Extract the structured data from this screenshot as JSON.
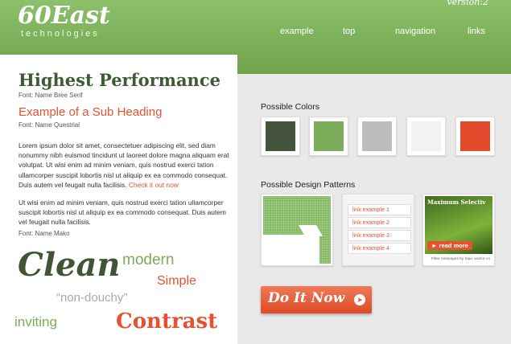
{
  "header": {
    "logo": "60East",
    "logo_sub": "technologies",
    "version": "version:2",
    "nav": [
      "example",
      "top",
      "navigation",
      "links"
    ]
  },
  "content": {
    "heading": "Highest Performance",
    "heading_font_note": "Font: Name Bree Serif",
    "subheading": "Example of a Sub Heading",
    "subheading_font_note": "Font: Name Questrial",
    "para1": "Lorem ipsum dolor sit amet, consectetuer adipiscing elit, sed diam nonummy nibh euismod tincidunt ut laoreet dolore magna aliquam erat volutpat. Ut wisi enim ad minim veniam, quis nostrud exerci tation ullamcorper suscipit lobortis nisl ut aliquip ex ea commodo consequat. Duis autem vel feugait nulla facilisis.",
    "para1_link": "Check it out now",
    "para2": "Ut wisi enim ad minim veniam, quis nostrud exerci tation ullamcorper suscipit lobortis nisl ut aliquip ex ea commodo consequat. Duis autem vel feugait nulla facilisis.",
    "body_font_note": "Font: Name Mako"
  },
  "word_cloud": [
    "Clean",
    "modern",
    "Simple",
    "“non-douchy”",
    "inviting",
    "Contrast"
  ],
  "colors": {
    "title": "Possible Colors",
    "swatches": [
      "#43523b",
      "#7cad5a",
      "#bdbdbd",
      "#f2f2f2",
      "#e24a2b"
    ]
  },
  "patterns": {
    "title": "Possible Design Patterns",
    "links": [
      "link example 1",
      "link example 2",
      "link example 3",
      "link example 4"
    ],
    "gallery_title": "Maximum Selectiv",
    "read_more": "read more",
    "caption": "Filter messages by topic and/or co"
  },
  "cta": {
    "label": "Do It Now"
  }
}
